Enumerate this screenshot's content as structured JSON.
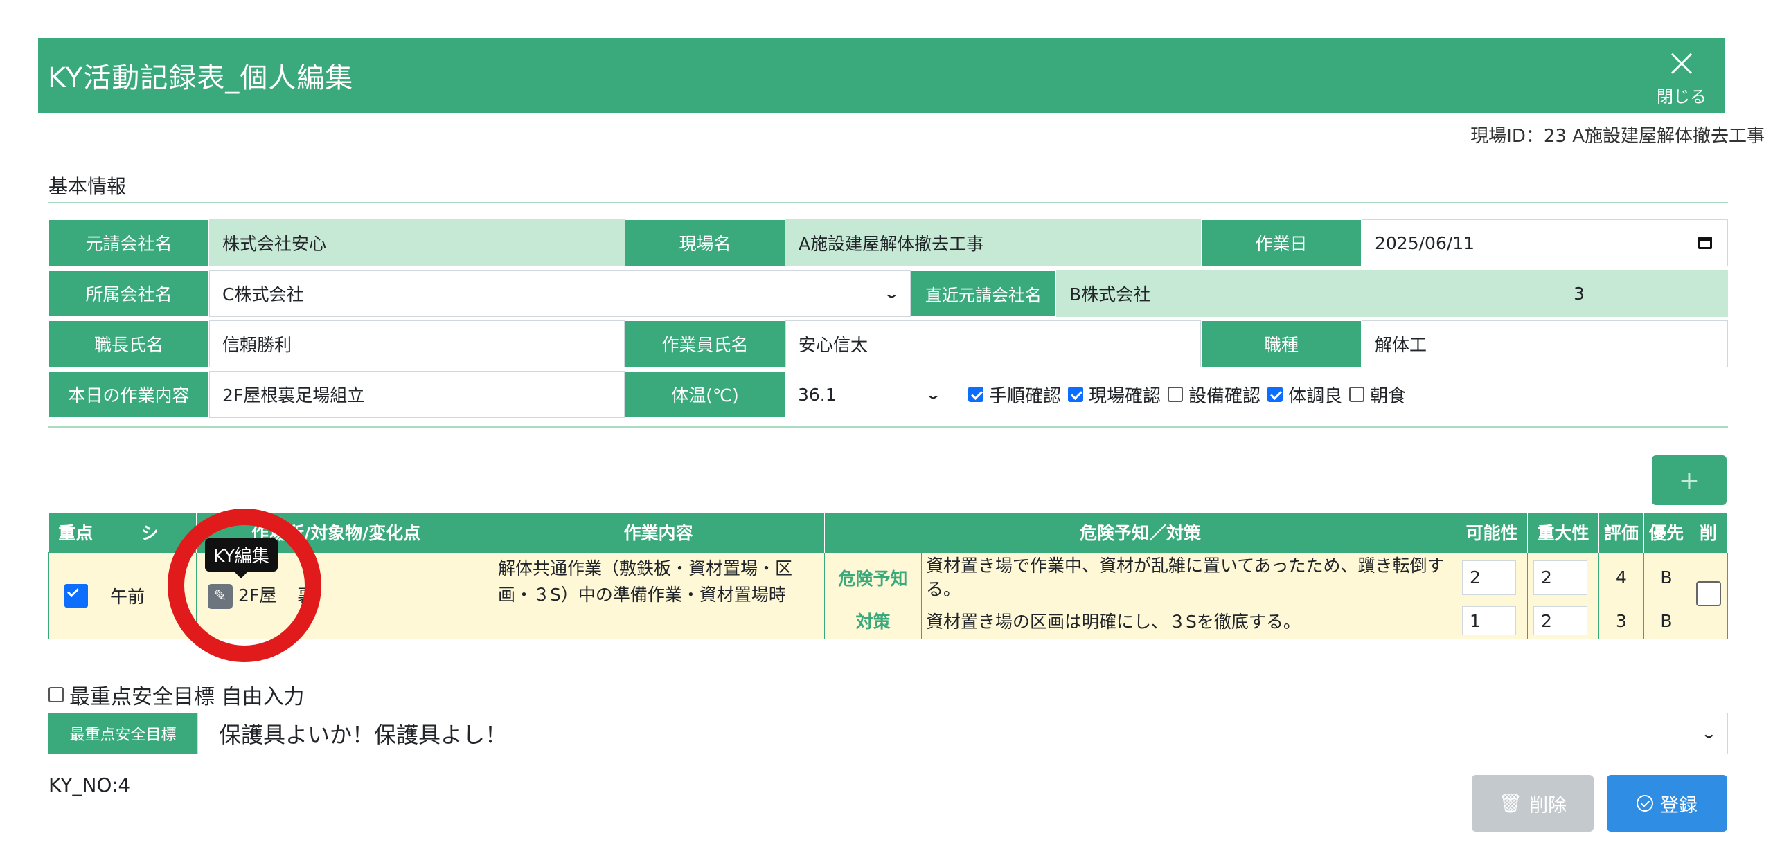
{
  "header": {
    "title": "KY活動記録表_個人編集",
    "close_label": "閉じる"
  },
  "site_id": "現場ID：23 A施設建屋解体撤去工事",
  "section_title": "基本情報",
  "info": {
    "prime_company_label": "元請会社名",
    "prime_company": "株式会社安心",
    "site_name_label": "現場名",
    "site_name": "A施設建屋解体撤去工事",
    "work_date_label": "作業日",
    "work_date": "2025/06/11",
    "affiliate_label": "所属会社名",
    "affiliate": "C株式会社",
    "direct_prime_label": "直近元請会社名",
    "direct_prime": "B株式会社",
    "direct_prime_num": "3",
    "foreman_label": "職長氏名",
    "foreman": "信頼勝利",
    "worker_label": "作業員氏名",
    "worker": "安心信太",
    "job_type_label": "職種",
    "job_type": "解体工",
    "task_label": "本日の作業内容",
    "task": "2F屋根裏足場組立",
    "temp_label": "体温(℃)",
    "temp": "36.1",
    "checks": [
      {
        "label": "手順確認",
        "checked": true
      },
      {
        "label": "現場確認",
        "checked": true
      },
      {
        "label": "設備確認",
        "checked": false
      },
      {
        "label": "体調良",
        "checked": true
      },
      {
        "label": "朝食",
        "checked": false
      }
    ]
  },
  "add_button": "+",
  "table": {
    "headers": [
      "重点",
      "シ",
      "作",
      "場所/対象物/変化点",
      "作業内容",
      "危険予知／対策",
      "可能性",
      "重大性",
      "評価",
      "優先",
      "削"
    ],
    "row": {
      "shift": "午前",
      "place": "2F屋",
      "place_tail": "裏",
      "work": "解体共通作業（敷鉄板・資材置場・区画・３S）中の準備作業・資材置場時",
      "hazard_tag": "危険予知",
      "hazard": "資材置き場で作業中、資材が乱雑に置いてあったため、躓き転倒する。",
      "measure_tag": "対策",
      "measure": "資材置き場の区画は明確にし、３Sを徹底する。",
      "hazard_possibility": "2",
      "hazard_severity": "2",
      "hazard_eval": "4",
      "hazard_priority": "B",
      "measure_possibility": "1",
      "measure_severity": "2",
      "measure_eval": "3",
      "measure_priority": "B"
    }
  },
  "tooltip": "KY編集",
  "free_input_label": "最重点安全目標 自由入力",
  "goal_label": "最重点安全目標",
  "goal_value": "保護具よいか！保護具よし！",
  "ky_no": "KY_NO:4",
  "delete_button": "削除",
  "register_button": "登録"
}
